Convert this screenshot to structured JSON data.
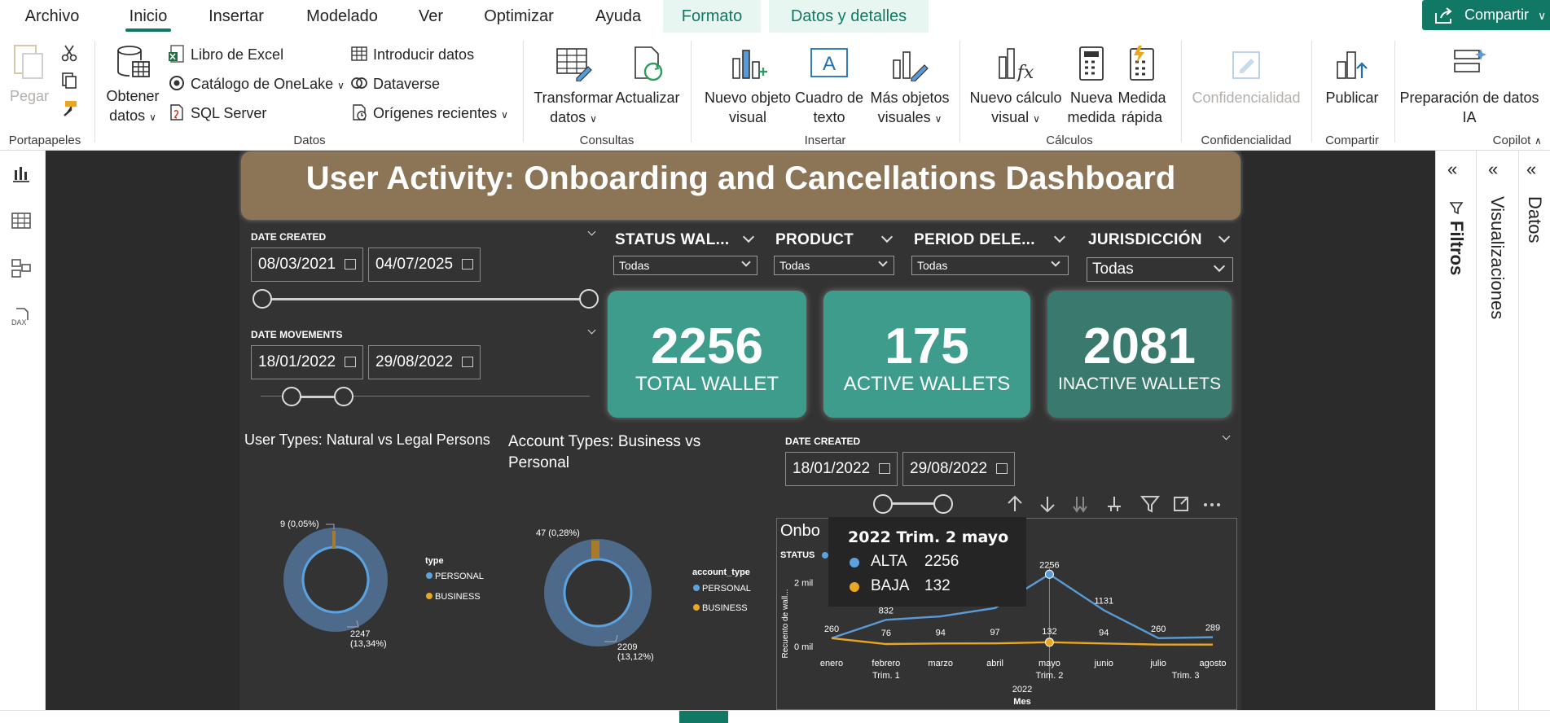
{
  "tabs": [
    "Archivo",
    "Inicio",
    "Insertar",
    "Modelado",
    "Ver",
    "Optimizar",
    "Ayuda",
    "Formato",
    "Datos y detalles"
  ],
  "share_label": "Compartir",
  "ribbon": {
    "pegar": "Pegar",
    "portapapeles": "Portapapeles",
    "obtener_datos_1": "Obtener",
    "obtener_datos_2": "datos",
    "libro_excel": "Libro de Excel",
    "catalogo": "Catálogo de OneLake",
    "sql_server": "SQL Server",
    "introducir_datos": "Introducir datos",
    "dataverse": "Dataverse",
    "origenes": "Orígenes recientes",
    "datos_group": "Datos",
    "transformar_1": "Transformar",
    "transformar_2": "datos",
    "actualizar": "Actualizar",
    "consultas": "Consultas",
    "nuevo_objeto_1": "Nuevo objeto",
    "nuevo_objeto_2": "visual",
    "cuadro_texto_1": "Cuadro de",
    "cuadro_texto_2": "texto",
    "mas_objetos_1": "Más objetos",
    "mas_objetos_2": "visuales",
    "insertar_group": "Insertar",
    "nuevo_calculo_1": "Nuevo cálculo",
    "nuevo_calculo_2": "visual",
    "nueva_medida_1": "Nueva",
    "nueva_medida_2": "medida",
    "medida_rapida_1": "Medida",
    "medida_rapida_2": "rápida",
    "calculos_group": "Cálculos",
    "confidencialidad": "Confidencialidad",
    "confidencialidad_group": "Confidencialidad",
    "publicar": "Publicar",
    "compartir_group": "Compartir",
    "prep_1": "Preparación de datos",
    "prep_2": "IA",
    "copilot_group": "Copilot"
  },
  "panes": {
    "filtros": "Filtros",
    "visualizaciones": "Visualizaciones",
    "datos": "Datos"
  },
  "report": {
    "title": "User Activity: Onboarding and Cancellations Dashboard",
    "slicer_created": {
      "title": "DATE CREATED",
      "from": "08/03/2021",
      "to": "04/07/2025"
    },
    "slicer_movements": {
      "title": "DATE MOVEMENTS",
      "from": "18/01/2022",
      "to": "29/08/2022"
    },
    "slicer_created_2": {
      "title": "DATE CREATED",
      "from": "18/01/2022",
      "to": "29/08/2022"
    },
    "dropdowns": [
      {
        "title": "STATUS WAL...",
        "value": "Todas"
      },
      {
        "title": "PRODUCT",
        "value": "Todas"
      },
      {
        "title": "PERIOD DELE...",
        "value": "Todas"
      },
      {
        "title": "JURISDICCIÓN",
        "value": "Todas"
      }
    ],
    "kpis": [
      {
        "value": "2256",
        "label": "TOTAL WALLET",
        "color": "#3e9c8c"
      },
      {
        "value": "175",
        "label": "ACTIVE WALLETS",
        "color": "#3e9c8c"
      },
      {
        "value": "2081",
        "label": "INACTIVE WALLETS",
        "color": "#3a7a6e"
      }
    ],
    "donut1": {
      "title": "User Types: Natural vs Legal Persons",
      "legend_title": "type",
      "legend": [
        "PERSONAL",
        "BUSINESS"
      ],
      "label_small": "9 (0,05%)",
      "label_big_1": "2247",
      "label_big_2": "(13,34%)"
    },
    "donut2": {
      "title_1": "Account Types: Business vs",
      "title_2": "Personal",
      "legend_title": "account_type",
      "legend": [
        "PERSONAL",
        "BUSINESS"
      ],
      "label_small": "47 (0,28%)",
      "label_big_1": "2209",
      "label_big_2": "(13,12%)"
    },
    "line": {
      "title": "Onbo",
      "status_label": "STATUS",
      "ylabel": "Recuento de wall...",
      "ytick_2": "2 mil",
      "ytick_0": "0 mil",
      "year": "2022",
      "xlabel": "Mes",
      "trim1": "Trim. 1",
      "trim2": "Trim. 2",
      "trim3": "Trim. 3",
      "tooltip": {
        "header": "2022 Trim. 2 mayo",
        "rows": [
          {
            "name": "ALTA",
            "value": "2256"
          },
          {
            "name": "BAJA",
            "value": "132"
          }
        ]
      }
    }
  },
  "chart_data": {
    "type": "line",
    "categories": [
      "enero",
      "febrero",
      "marzo",
      "abril",
      "mayo",
      "junio",
      "julio",
      "agosto"
    ],
    "series": [
      {
        "name": "ALTA",
        "color": "#5b9bd5",
        "values": [
          260,
          832,
          940,
          1200,
          2256,
          1131,
          260,
          289
        ]
      },
      {
        "name": "BAJA",
        "color": "#e8a623",
        "values": [
          260,
          76,
          94,
          97,
          132,
          94,
          60,
          60
        ]
      }
    ],
    "labels_alta": [
      "260",
      "832",
      "",
      "",
      "2256",
      "1131",
      "260",
      "289"
    ],
    "labels_baja": [
      "",
      "76",
      "94",
      "97",
      "132",
      "94",
      "",
      ""
    ],
    "ylim": [
      0,
      3000
    ]
  },
  "colors": {
    "accent": "#117865",
    "title_bar": "#8b7556",
    "canvas": "#333333"
  }
}
